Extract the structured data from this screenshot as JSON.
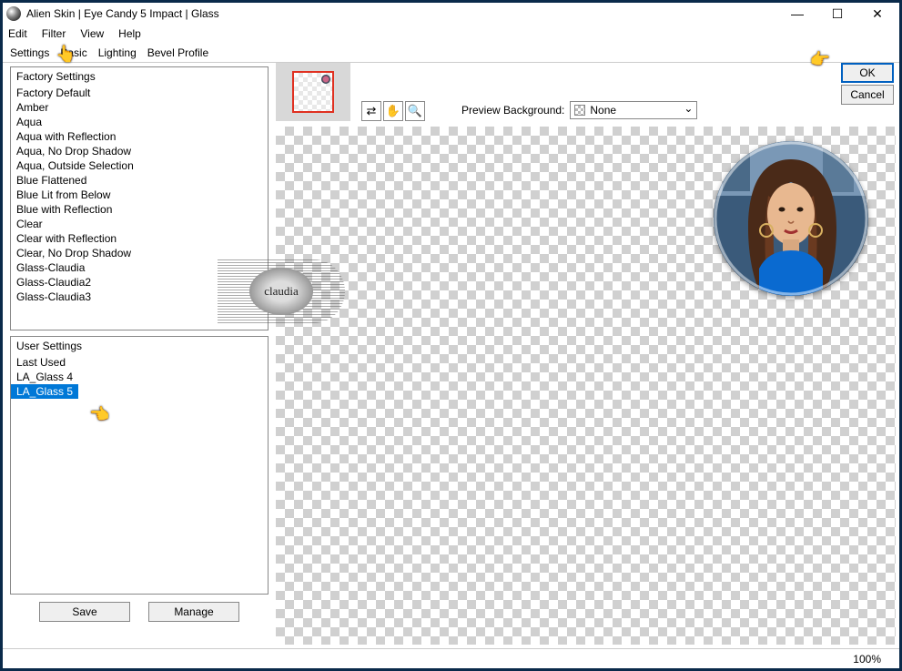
{
  "window": {
    "title": "Alien Skin | Eye Candy 5 Impact | Glass"
  },
  "menu": {
    "edit": "Edit",
    "filter": "Filter",
    "view": "View",
    "help": "Help"
  },
  "tabs": {
    "settings": "Settings",
    "basic": "Basic",
    "lighting": "Lighting",
    "bevel": "Bevel Profile"
  },
  "factory": {
    "header": "Factory Settings",
    "items": [
      "Factory Default",
      "Amber",
      "Aqua",
      "Aqua with Reflection",
      "Aqua, No Drop Shadow",
      "Aqua, Outside Selection",
      "Blue Flattened",
      "Blue Lit from Below",
      "Blue with Reflection",
      "Clear",
      "Clear with Reflection",
      "Clear, No Drop Shadow",
      "Glass-Claudia",
      "Glass-Claudia2",
      "Glass-Claudia3"
    ]
  },
  "user": {
    "header": "User Settings",
    "items": [
      "Last Used",
      "LA_Glass 4",
      "LA_Glass 5"
    ],
    "selected_index": 2
  },
  "buttons": {
    "save": "Save",
    "manage": "Manage",
    "ok": "OK",
    "cancel": "Cancel"
  },
  "preview_bg": {
    "label": "Preview Background:",
    "value": "None"
  },
  "status": {
    "zoom": "100%"
  },
  "watermark": "claudia",
  "icons": {
    "arrows": "⇄",
    "hand": "✋",
    "magnifier": "🔍"
  }
}
